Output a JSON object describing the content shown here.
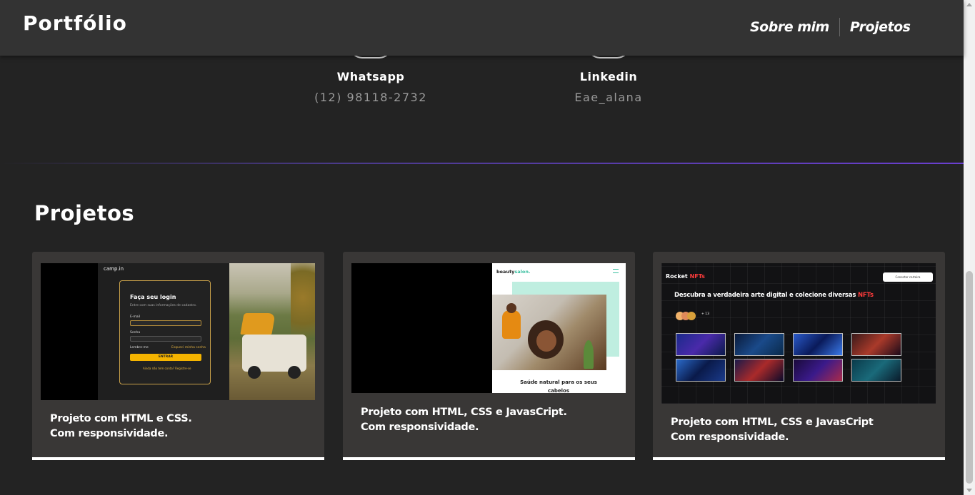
{
  "header": {
    "logo": "Portfólio",
    "nav": [
      {
        "label": "Sobre mim"
      },
      {
        "label": "Projetos"
      }
    ]
  },
  "contacts": [
    {
      "title": "Whatsapp",
      "value": "(12) 98118-2732",
      "icon": "whatsapp-icon"
    },
    {
      "title": "Linkedin",
      "value": "Eae_alana",
      "icon": "linkedin-icon"
    }
  ],
  "projects_section": {
    "title": "Projetos",
    "cards": [
      {
        "line1": "Projeto com HTML e CSS.",
        "line2": "Com responsividade.",
        "preview": {
          "brand": "camp.in",
          "form_title": "Faça seu login",
          "form_subtitle": "Entre com suas informações de cadastro.",
          "email_label": "E-mail",
          "password_label": "Senha",
          "remember": "Lembre-me",
          "forgot": "Esqueci minha senha",
          "button": "ENTRAR",
          "signup": "Ainda não tem conta? Registre-se"
        }
      },
      {
        "line1": "Projeto com HTML, CSS e JavasCript.",
        "line2": "Com responsividade.",
        "preview": {
          "brand_a": "beauty",
          "brand_b": "salon.",
          "heading_a": "Saúde natural para",
          "heading_b": "os seus",
          "heading_c": "cabelos"
        }
      },
      {
        "line1": "Projeto com HTML, CSS e JavasCript",
        "line2": "Com responsividade.",
        "preview": {
          "brand_a": "Rocket",
          "brand_b": "NFTs",
          "button": "Conectar carteira",
          "heading_a": "Descubra a verdadeira arte digital e colecione diversas",
          "heading_b": "NFTs",
          "count": "+ 13"
        }
      }
    ]
  },
  "colors": {
    "background": "#232323",
    "header": "#333333",
    "card": "#393736",
    "accent_purple": "#6a3fd0"
  }
}
